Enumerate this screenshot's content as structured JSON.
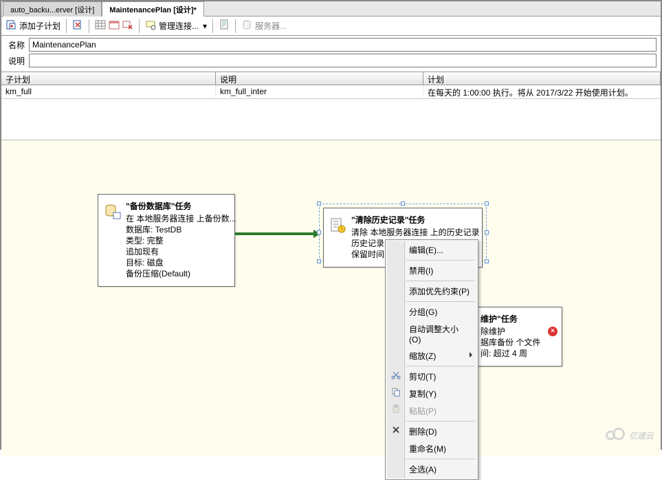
{
  "tabs": [
    {
      "label": "auto_backu...erver [设计]"
    },
    {
      "label": "MaintenancePlan [设计]*"
    }
  ],
  "toolbar": {
    "add_subplan": "添加子计划",
    "manage_conn": "管理连接...",
    "servers": "服务器..."
  },
  "props": {
    "name_label": "名称",
    "name_value": "MaintenancePlan",
    "desc_label": "说明",
    "desc_value": ""
  },
  "grid": {
    "headers": {
      "c1": "子计划",
      "c2": "说明",
      "c3": "计划"
    },
    "row": {
      "c1": "km_full",
      "c2": "km_full_inter",
      "c3": "在每天的 1:00:00 执行。将从 2017/3/22 开始使用计划。"
    }
  },
  "task_backup": {
    "title": "\"备份数据库\"任务",
    "l1": "在 本地服务器连接 上备份数...",
    "l2": "数据库: TestDB",
    "l3": "类型: 完整",
    "l4": "追加现有",
    "l5": "目标: 磁盘",
    "l6": "备份压缩(Default)"
  },
  "task_history": {
    "title": "\"清除历史记录\"任务",
    "l1": "清除 本地服务器连接 上的历史记录",
    "l2": "历史记录",
    "l3": "保留时间"
  },
  "task_maint": {
    "title_suffix": "维护\"任务",
    "l1": "除维护",
    "l2": "据库备份 个文件",
    "l3": "间: 超过 4 周"
  },
  "context_menu": {
    "edit": "编辑(E)...",
    "disable": "禁用(I)",
    "add_precedence": "添加优先约束(P)",
    "group": "分组(G)",
    "autosize": "自动调整大小(O)",
    "zoom": "缩放(Z)",
    "cut": "剪切(T)",
    "copy": "复制(Y)",
    "paste": "粘贴(P)",
    "delete": "删除(D)",
    "rename": "重命名(M)",
    "select_all": "全选(A)"
  },
  "watermark": "亿速云"
}
